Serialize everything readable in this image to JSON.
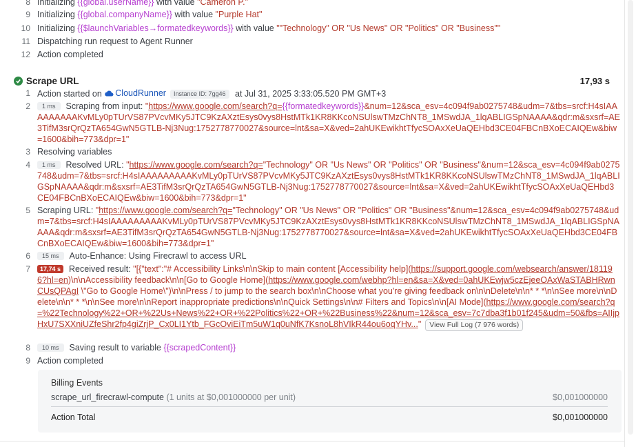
{
  "top_lines": [
    {
      "num": "8",
      "pre": "Initializing ",
      "var": "{{global.userName}}",
      "mid": " with value ",
      "str": "\"Cameron P.\""
    },
    {
      "num": "9",
      "pre": "Initializing ",
      "var": "{{global.companyName}}",
      "mid": " with value ",
      "str": "\"Purple Hat\""
    },
    {
      "num": "10",
      "pre": "Initializing ",
      "var": "{{$launchVariables→formatedkeywords}}",
      "mid": " with value ",
      "str": "\"\"Technology\" OR \"Us News\" OR \"Politics\" OR \"Business\"\""
    },
    {
      "num": "11",
      "text": "Dispatching run request to Agent Runner"
    },
    {
      "num": "12",
      "text": "Action completed"
    }
  ],
  "section": {
    "title": "Scrape URL",
    "duration": "17,93 s",
    "status_icon": "check-circle-icon"
  },
  "line1": {
    "num": "1",
    "pre": "Action started on ",
    "runner": "CloudRunner",
    "instance": "Instance ID: 7gg46",
    "post": " at Jul 31, 2025 3:33:05.520 PM GMT+3"
  },
  "line2": {
    "num": "2",
    "badge": "1 ms",
    "pre": "Scraping from input: ",
    "q": "\"",
    "link": "https://www.google.com/search?q=",
    "var": "{{formatedkeywords}}",
    "tail": "&num=12&sca_esv=4c094f9ab0275748&udm=7&tbs=srcf:H4sIAAAAAAAAAKvMLy0pTUrVS87PVcvMKy5JTC9KzAXztEsys0vys8HstMTk1KR8KKcoNSUlswTMzChNT8_1MSwdJA_1lqABLIGSpNAAAA&qdr:m&sxsrf=AE3TifM3srQrQzTA654GwN5GTLB-Nj3Nug:1752778770027&source=lnt&sa=X&ved=2ahUKEwikhtTfycSOAxXeUaQEHbd3CE04FBCnBXoECAIQEw&biw=1600&bih=773&dpr=1\""
  },
  "line3": {
    "num": "3",
    "text": "Resolving variables"
  },
  "line4": {
    "num": "4",
    "badge": "1 ms",
    "pre": "Resolved URL: ",
    "q": "\"",
    "link": "https://www.google.com/search?q=",
    "tail": "\"Technology\" OR \"Us News\" OR \"Politics\" OR \"Business\"&num=12&sca_esv=4c094f9ab0275748&udm=7&tbs=srcf:H4sIAAAAAAAAAKvMLy0pTUrVS87PVcvMKy5JTC9KzAXztEsys0vys8HstMTk1KR8KKcoNSUlswTMzChNT8_1MSwdJA_1lqABLIGSpNAAAA&qdr:m&sxsrf=AE3TifM3srQrQzTA654GwN5GTLB-Nj3Nug:1752778770027&source=lnt&sa=X&ved=2ahUKEwikhtTfycSOAxXeUaQEHbd3CE04FBCnBXoECAIQEw&biw=1600&bih=773&dpr=1\""
  },
  "line5": {
    "num": "5",
    "pre": "Scraping URL: ",
    "q": "\"",
    "link": "https://www.google.com/search?q=",
    "tail": "\"Technology\" OR \"Us News\" OR \"Politics\" OR \"Business\"&num=12&sca_esv=4c094f9ab0275748&udm=7&tbs=srcf:H4sIAAAAAAAAAKvMLy0pTUrVS87PVcvMKy5JTC9KzAXztEsys0vys8HstMTk1KR8KKcoNSUlswTMzChNT8_1MSwdJA_1lqABLIGSpNAAAA&qdr:m&sxsrf=AE3TifM3srQrQzTA654GwN5GTLB-Nj3Nug:1752778770027&source=lnt&sa=X&ved=2ahUKEwikhtTfycSOAxXeUaQEHbd3CE04FBCnBXoECAIQEw&biw=1600&bih=773&dpr=1\""
  },
  "line6": {
    "num": "6",
    "badge": "15 ms",
    "text": "Auto-Enhance: Using Firecrawl to access URL"
  },
  "line7": {
    "num": "7",
    "badge": "17,74 s",
    "pre": "Received result: ",
    "s1": "\"[{\"text\":\"# Accessibility Links\\n\\nSkip to main content [Accessibility help](",
    "l1": "https://support.google.com/websearch/answer/181196?hl=en",
    "s2": ")\\n\\nAccessibility feedback\\n\\n[Go to Google Home](",
    "l2": "https://www.google.com/webhp?hl=en&sa=X&ved=0ahUKEwjw5czEjeeOAxWaSTABHRwnCUsQPAgI",
    "s3": " \\\"Go to Google Home\\\")\\n\\nPress / to jump to the search box\\n\\nChoose what you're giving feedback on\\n\\nDelete\\n\\n* * *\\n\\nSee more\\n\\nDelete\\n\\n* * *\\n\\nSee more\\n\\nReport inappropriate predictions\\n\\nQuick Settings\\n\\n# Filters and Topics\\n\\n[AI Mode](",
    "l3": "https://www.google.com/search?q=%22Technology%22+OR+%22Us+News%22+OR+%22Politics%22+OR+%22Business%22&num=12&sca_esv=7c7dba3f1b01f245&udm=50&fbs=AIIjpHxU7SXXniUZfeShr2fp4giZrjP_Cx0LI1Ytb_FGcOviEiTm5uW1q0uNfK7KsnoL8hVIkR44ou6oqYHv...",
    "s4": "\"",
    "button": "View Full Log (7 976 words)"
  },
  "line8": {
    "num": "8",
    "badge": "10 ms",
    "pre": "Saving result to variable ",
    "var": "{{scrapedContent}}"
  },
  "line9": {
    "num": "9",
    "text": "Action completed"
  },
  "billing": {
    "title": "Billing Events",
    "item": "scrape_url_firecrawl-compute",
    "detail": "(1 units at $0,001000000 per unit)",
    "amount": "$0,001000000",
    "total_label": "Action Total",
    "total": "$0,001000000"
  }
}
